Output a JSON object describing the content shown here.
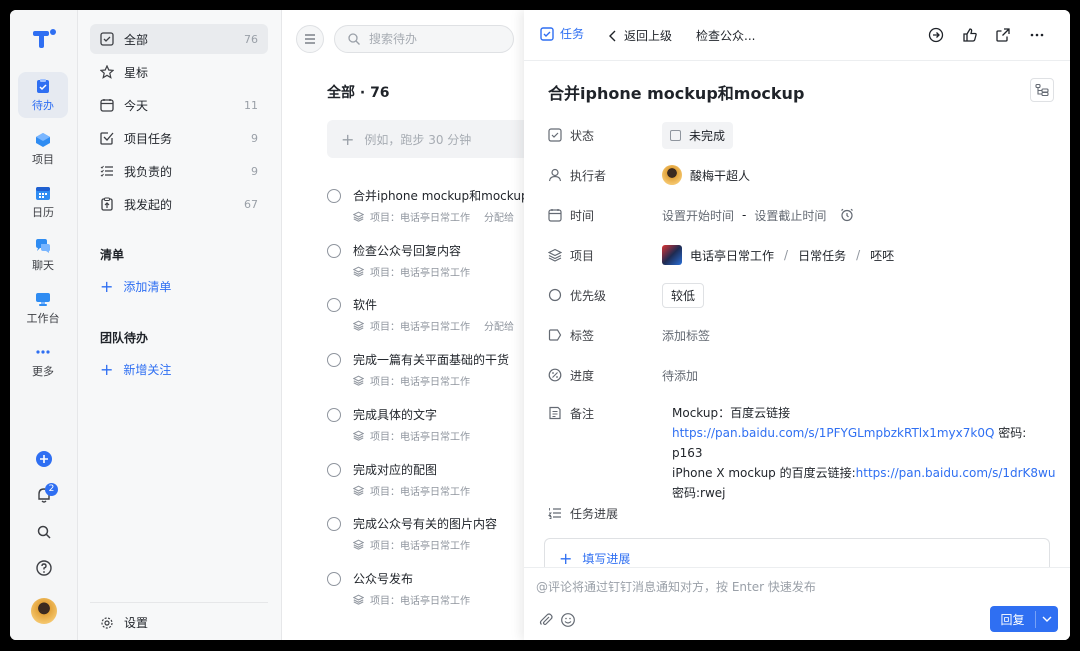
{
  "rail": {
    "items": [
      {
        "label": "待办",
        "icon": "clipboard-icon"
      },
      {
        "label": "项目",
        "icon": "cube-icon"
      },
      {
        "label": "日历",
        "icon": "calendar-icon"
      },
      {
        "label": "聊天",
        "icon": "chat-icon"
      },
      {
        "label": "工作台",
        "icon": "workbench-icon"
      },
      {
        "label": "更多",
        "icon": "more-icon"
      }
    ],
    "notification_count": "2"
  },
  "nav": {
    "items": [
      {
        "label": "全部",
        "count": "76",
        "icon": "checkbox-icon"
      },
      {
        "label": "星标",
        "count": "",
        "icon": "star-icon"
      },
      {
        "label": "今天",
        "count": "11",
        "icon": "calendar-icon"
      },
      {
        "label": "项目任务",
        "count": "9",
        "icon": "check-square-icon"
      },
      {
        "label": "我负责的",
        "count": "9",
        "icon": "list-check-icon"
      },
      {
        "label": "我发起的",
        "count": "67",
        "icon": "clipboard-up-icon"
      }
    ],
    "section_list": "清单",
    "add_list": "添加清单",
    "section_team": "团队待办",
    "add_follow": "新增关注",
    "settings": "设置"
  },
  "tasks": {
    "search_placeholder": "搜索待办",
    "title": "全部 · 76",
    "quick_add_placeholder": "例如，跑步 30 分钟",
    "items": [
      {
        "title": "合并iphone mockup和mockup",
        "meta": "项目：电话亭日常工作",
        "assign": "分配给"
      },
      {
        "title": "检查公众号回复内容",
        "meta": "项目：电话亭日常工作",
        "assign": ""
      },
      {
        "title": "软件",
        "meta": "项目：电话亭日常工作",
        "assign": "分配给"
      },
      {
        "title": "完成一篇有关平面基础的干货",
        "meta": "项目：电话亭日常工作",
        "assign": ""
      },
      {
        "title": "完成具体的文字",
        "meta": "项目：电话亭日常工作",
        "assign": ""
      },
      {
        "title": "完成对应的配图",
        "meta": "项目：电话亭日常工作",
        "assign": ""
      },
      {
        "title": "完成公众号有关的图片内容",
        "meta": "项目：电话亭日常工作",
        "assign": ""
      },
      {
        "title": "公众号发布",
        "meta": "项目：电话亭日常工作",
        "assign": ""
      }
    ]
  },
  "detail": {
    "tag": "任务",
    "back": "返回上级",
    "crumb": "检查公众...",
    "title": "合并iphone mockup和mockup",
    "fields": {
      "status_label": "状态",
      "status_value": "未完成",
      "assignee_label": "执行者",
      "assignee_value": "酸梅干超人",
      "time_label": "时间",
      "time_start": "设置开始时间",
      "time_dash": "-",
      "time_end": "设置截止时间",
      "project_label": "项目",
      "project_name": "电话亭日常工作",
      "project_sep": "/",
      "project_group": "日常任务",
      "project_stage": "呸呸",
      "priority_label": "优先级",
      "priority_value": "较低",
      "tag_label": "标签",
      "tag_value": "添加标签",
      "progress_label": "进度",
      "progress_value": "待添加",
      "note_label": "备注",
      "task_progress_label": "任务进展"
    },
    "note": {
      "line1": "Mockup：百度云链接",
      "link1": "https://pan.baidu.com/s/1PFYGLmpbzkRTlx1myx7k0Q",
      "pwd1": " 密码: p163",
      "line3_text": "iPhone X mockup 的百度云链接:",
      "link2": "https://pan.baidu.com/s/1drK8wu",
      "line4": "密码:rwej"
    },
    "add_progress": "填写进展",
    "comment_placeholder": "@评论将通过钉钉消息通知对方，按 Enter 快速发布",
    "reply": "回复"
  },
  "colors": {
    "accent": "#2f6ff2"
  }
}
